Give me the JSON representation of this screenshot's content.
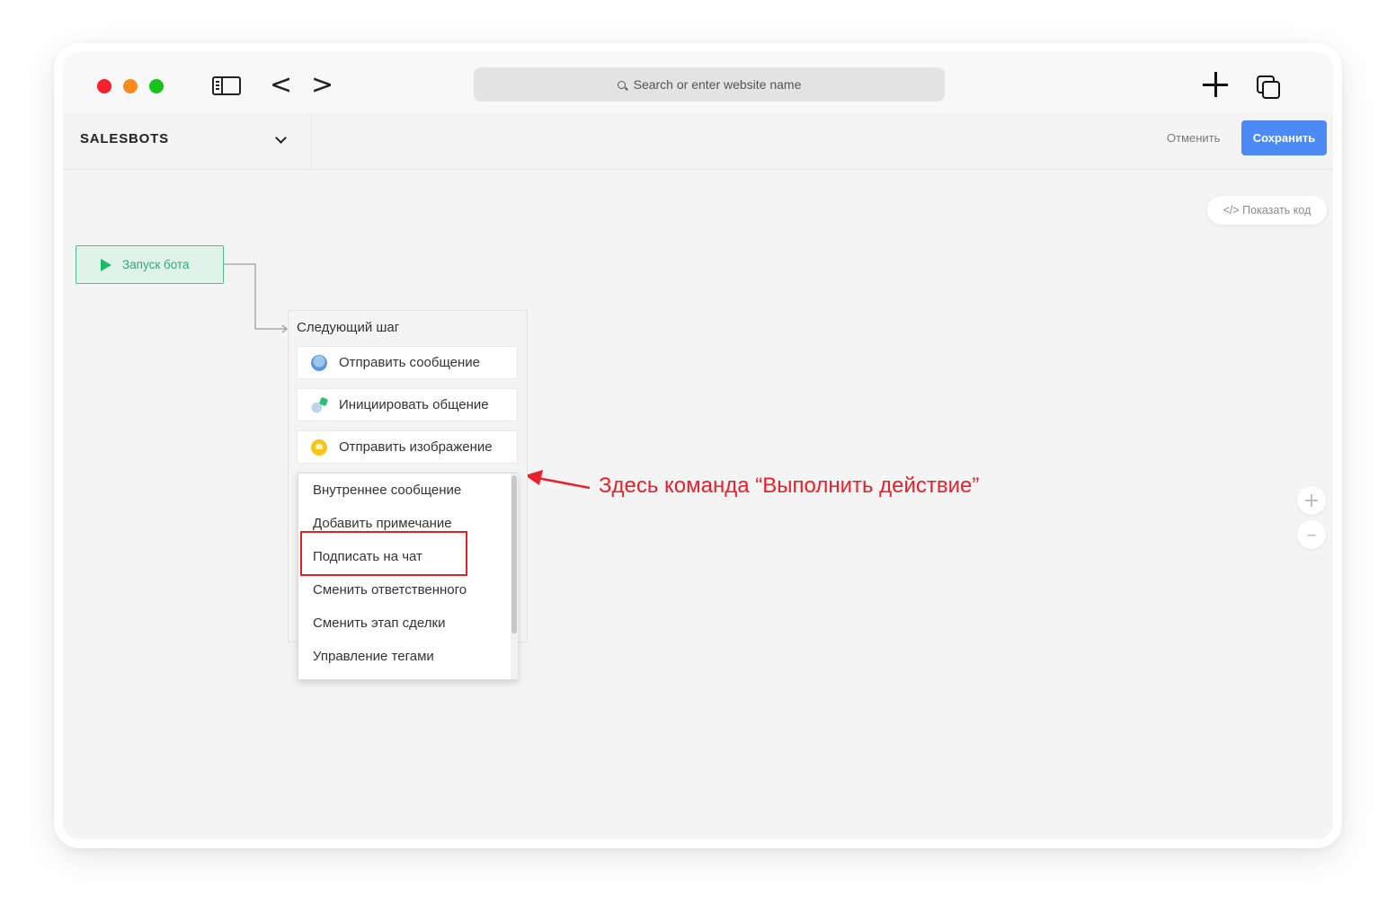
{
  "browser": {
    "url_placeholder": "Search or enter website name",
    "icons": [
      "sidebar-toggle-icon",
      "back-arrow-icon",
      "forward-arrow-icon",
      "search-icon",
      "plus-icon",
      "tabs-icon"
    ]
  },
  "header": {
    "title": "SALESBOTS",
    "cancel_label": "Отменить",
    "save_label": "Сохранить",
    "accent_color": "#4c8bf5"
  },
  "canvas": {
    "show_code_label": "</> Показать код",
    "zoom_in_label": "+",
    "zoom_out_label": "–"
  },
  "flow": {
    "start_label": "Запуск бота",
    "next_step_title": "Следующий шаг",
    "step_items": [
      {
        "label": "Отправить сообщение",
        "icon": "message-icon"
      },
      {
        "label": "Инициировать общение",
        "icon": "initiate-icon"
      },
      {
        "label": "Отправить изображение",
        "icon": "image-icon"
      }
    ],
    "dropdown_items": [
      "Внутреннее сообщение",
      "Добавить примечание",
      "Подписать на чат",
      "Сменить ответственного",
      "Сменить этап сделки",
      "Управление тегами"
    ]
  },
  "annotation": {
    "text": "Здесь команда “Выполнить действие”",
    "color": "#e8202a"
  }
}
